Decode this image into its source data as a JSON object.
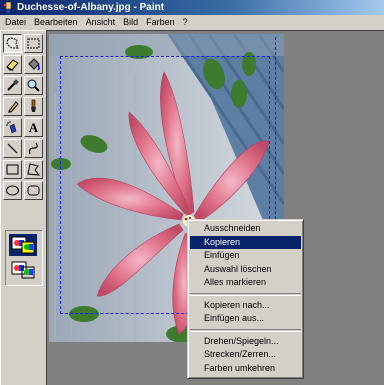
{
  "window": {
    "title": "Duchesse-of-Albany.jpg - Paint",
    "app_icon": "paint-icon"
  },
  "menubar": {
    "items": [
      "Datei",
      "Bearbeiten",
      "Ansicht",
      "Bild",
      "Farben",
      "?"
    ]
  },
  "toolbox": {
    "tools": [
      {
        "icon": "free-form-select-icon",
        "pressed": true
      },
      {
        "icon": "rectangle-select-icon",
        "pressed": false
      },
      {
        "icon": "eraser-icon",
        "pressed": false
      },
      {
        "icon": "fill-bucket-icon",
        "pressed": false
      },
      {
        "icon": "color-picker-icon",
        "pressed": false
      },
      {
        "icon": "magnifier-icon",
        "pressed": false
      },
      {
        "icon": "pencil-icon",
        "pressed": false
      },
      {
        "icon": "brush-icon",
        "pressed": false
      },
      {
        "icon": "airbrush-icon",
        "pressed": false
      },
      {
        "icon": "text-tool-icon",
        "pressed": false
      },
      {
        "icon": "line-icon",
        "pressed": false
      },
      {
        "icon": "curve-icon",
        "pressed": false
      },
      {
        "icon": "rectangle-icon",
        "pressed": false
      },
      {
        "icon": "polygon-icon",
        "pressed": false
      },
      {
        "icon": "ellipse-icon",
        "pressed": false
      },
      {
        "icon": "rounded-rectangle-icon",
        "pressed": false
      }
    ],
    "text_tool_glyph": "A",
    "selection_options": [
      "opaque-selection-icon",
      "transparent-selection-icon"
    ]
  },
  "canvas": {
    "image": "pink-clematis-flower-photo",
    "colors": {
      "petal": "#d9607a",
      "petal_light": "#f0a0b4",
      "leaf": "#3f7a2f",
      "roof": "#5f7fa0",
      "wall": "#c9cfd6"
    }
  },
  "context_menu": {
    "items": [
      {
        "label": "Ausschneiden",
        "highlighted": false
      },
      {
        "label": "Kopieren",
        "highlighted": true
      },
      {
        "label": "Einfügen",
        "highlighted": false
      },
      {
        "label": "Auswahl löschen",
        "highlighted": false
      },
      {
        "label": "Alles markieren",
        "highlighted": false
      },
      {
        "separator": true
      },
      {
        "label": "Kopieren nach...",
        "highlighted": false
      },
      {
        "label": "Einfügen aus...",
        "highlighted": false
      },
      {
        "separator": true
      },
      {
        "label": "Drehen/Spiegeln...",
        "highlighted": false
      },
      {
        "label": "Strecken/Zerren...",
        "highlighted": false
      },
      {
        "label": "Farben umkehren",
        "highlighted": false
      }
    ]
  }
}
